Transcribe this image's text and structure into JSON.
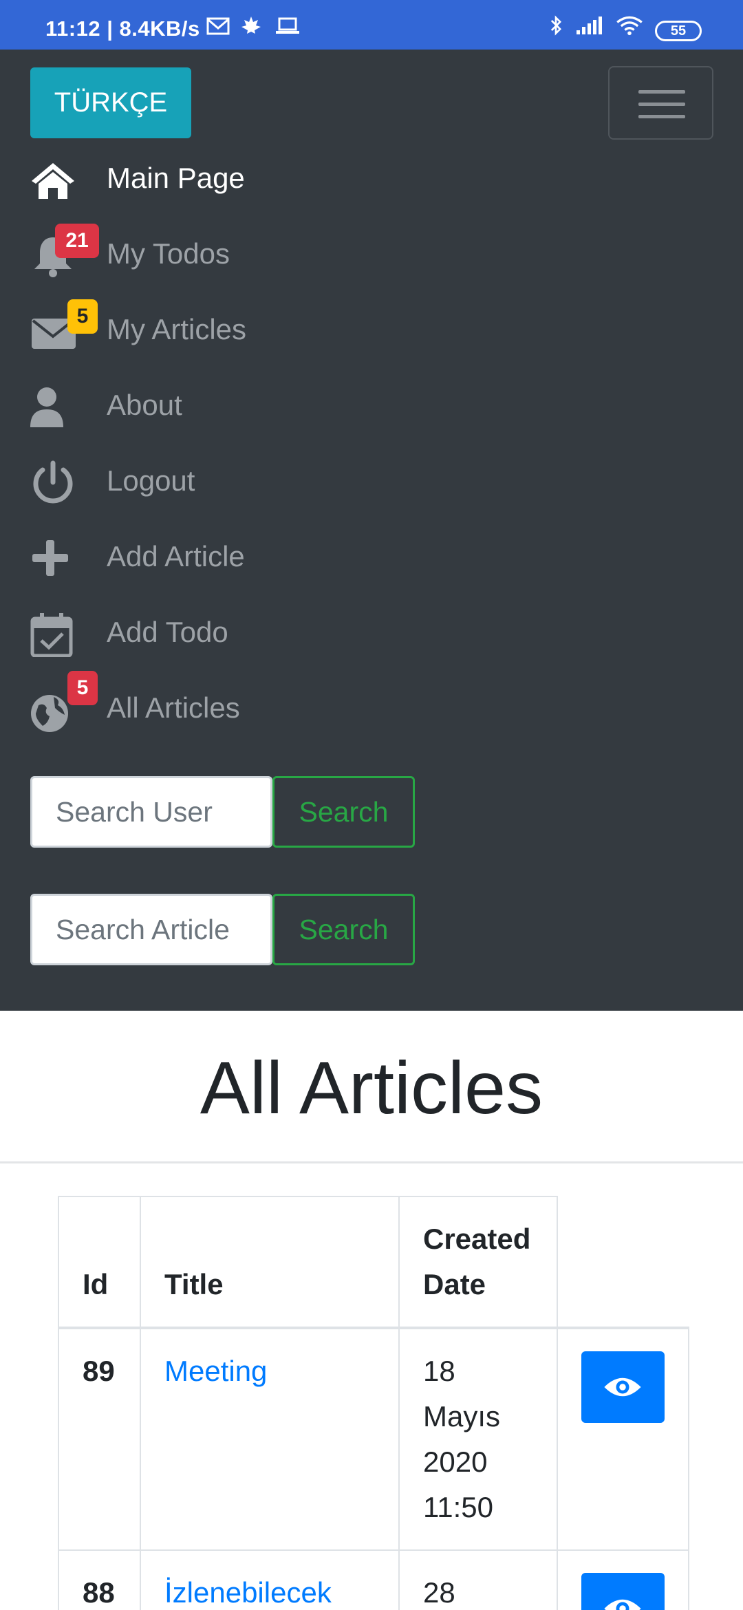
{
  "status_bar": {
    "time": "11:12 | 8.4KB/s",
    "battery": "55",
    "icons": [
      "gmail-icon",
      "maple-leaf-icon",
      "laptop-icon",
      "bluetooth-icon",
      "signal-icon",
      "wifi-icon",
      "battery-icon"
    ]
  },
  "navbar": {
    "language_button": "TÜRKÇE",
    "toggler_icon": "hamburger-icon",
    "items": [
      {
        "label": "Main Page",
        "icon": "home-icon",
        "active": true
      },
      {
        "label": "My Todos",
        "icon": "bell-icon",
        "badge": "21",
        "badge_color": "#dc3545"
      },
      {
        "label": "My Articles",
        "icon": "envelope-icon",
        "badge": "5",
        "badge_color": "#ffc107"
      },
      {
        "label": "About",
        "icon": "user-icon"
      },
      {
        "label": "Logout",
        "icon": "power-icon"
      },
      {
        "label": "Add Article",
        "icon": "plus-icon"
      },
      {
        "label": "Add Todo",
        "icon": "calendar-check-icon"
      },
      {
        "label": "All Articles",
        "icon": "globe-icon",
        "badge": "5",
        "badge_color": "#dc3545"
      }
    ],
    "search_user": {
      "placeholder": "Search User",
      "button": "Search"
    },
    "search_article": {
      "placeholder": "Search Article",
      "button": "Search"
    }
  },
  "main": {
    "title": "All Articles",
    "table": {
      "headers": [
        "Id",
        "Title",
        "Created Date",
        ""
      ],
      "rows": [
        {
          "id": "89",
          "title": "Meeting",
          "date": "18 Mayıs 2020 11:50",
          "action_icon": "eye-icon"
        },
        {
          "id": "88",
          "title": "İzlenebilecek",
          "date": "28",
          "action_icon": "eye-icon"
        }
      ]
    }
  },
  "colors": {
    "status_bar": "#3367d6",
    "navbar": "#343a40",
    "info": "#17a2b8",
    "success": "#28a745",
    "primary": "#007bff",
    "danger": "#dc3545",
    "warning": "#ffc107"
  }
}
